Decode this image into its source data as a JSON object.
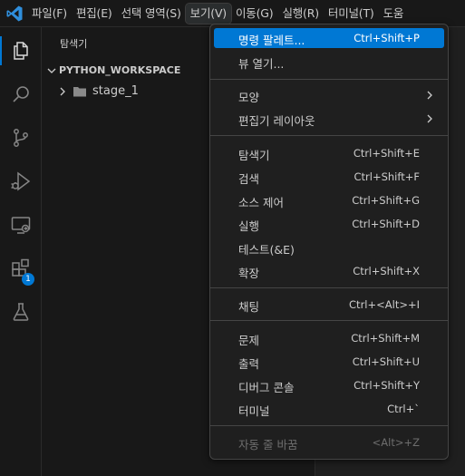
{
  "menubar": {
    "items": [
      {
        "label": "파일(F)"
      },
      {
        "label": "편집(E)"
      },
      {
        "label": "선택 영역(S)"
      },
      {
        "label": "보기(V)"
      },
      {
        "label": "이동(G)"
      },
      {
        "label": "실행(R)"
      },
      {
        "label": "터미널(T)"
      },
      {
        "label": "도움"
      }
    ],
    "active_index": 3
  },
  "activitybar": {
    "icons": [
      "explorer-icon",
      "search-icon",
      "source-control-icon",
      "run-debug-icon",
      "remote-explorer-icon",
      "extensions-icon",
      "testing-icon"
    ],
    "extensions_badge": "1"
  },
  "sidebar": {
    "title": "탐색기",
    "workspace": "PYTHON_WORKSPACE",
    "folder": "stage_1"
  },
  "view_menu": {
    "groups": [
      [
        {
          "label": "명령 팔레트...",
          "shortcut": "Ctrl+Shift+P",
          "highlighted": true
        },
        {
          "label": "뷰 열기...",
          "shortcut": ""
        }
      ],
      [
        {
          "label": "모양",
          "shortcut": "",
          "submenu": true
        },
        {
          "label": "편집기 레이아웃",
          "shortcut": "",
          "submenu": true
        }
      ],
      [
        {
          "label": "탐색기",
          "shortcut": "Ctrl+Shift+E"
        },
        {
          "label": "검색",
          "shortcut": "Ctrl+Shift+F"
        },
        {
          "label": "소스 제어",
          "shortcut": "Ctrl+Shift+G"
        },
        {
          "label": "실행",
          "shortcut": "Ctrl+Shift+D"
        },
        {
          "label": "테스트(&E)",
          "shortcut": ""
        },
        {
          "label": "확장",
          "shortcut": "Ctrl+Shift+X"
        }
      ],
      [
        {
          "label": "채팅",
          "shortcut": "Ctrl+<Alt>+I"
        }
      ],
      [
        {
          "label": "문제",
          "shortcut": "Ctrl+Shift+M"
        },
        {
          "label": "출력",
          "shortcut": "Ctrl+Shift+U"
        },
        {
          "label": "디버그 콘솔",
          "shortcut": "Ctrl+Shift+Y"
        },
        {
          "label": "터미널",
          "shortcut": "Ctrl+`"
        }
      ],
      [
        {
          "label": "자동 줄 바꿈",
          "shortcut": "<Alt>+Z",
          "disabled": true
        }
      ]
    ]
  },
  "colors": {
    "accent": "#0078d4",
    "background": "#1f1f1f",
    "sidebar": "#181818"
  }
}
